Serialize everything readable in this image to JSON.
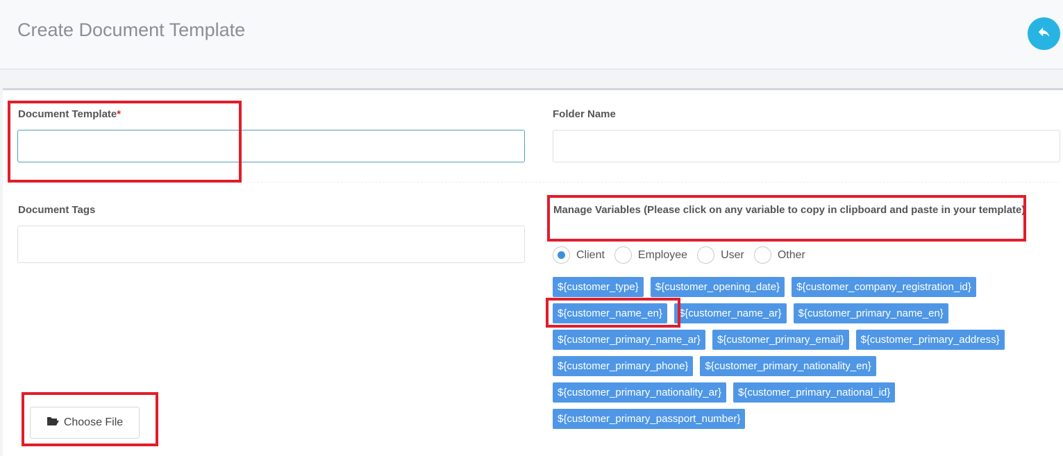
{
  "header": {
    "title": "Create Document Template"
  },
  "form": {
    "document_template": {
      "label": "Document Template",
      "required_mark": "*",
      "value": ""
    },
    "folder_name": {
      "label": "Folder Name",
      "value": ""
    },
    "document_tags": {
      "label": "Document Tags",
      "value": ""
    },
    "variables": {
      "label": "Manage Variables (Please click on any variable to copy in clipboard and paste in your template)",
      "radio_options": [
        "Client",
        "Employee",
        "User",
        "Other"
      ],
      "selected": "Client",
      "chips": [
        [
          "${customer_type}",
          "${customer_opening_date}",
          "${customer_company_registration_id}"
        ],
        [
          "${customer_name_en}",
          "${customer_name_ar}",
          "${customer_primary_name_en}"
        ],
        [
          "${customer_primary_name_ar}",
          "${customer_primary_email}",
          "${customer_primary_address}"
        ],
        [
          "${customer_primary_phone}",
          "${customer_primary_nationality_en}"
        ],
        [
          "${customer_primary_nationality_ar}",
          "${customer_primary_national_id}"
        ],
        [
          "${customer_primary_passport_number}"
        ]
      ]
    },
    "file_button": {
      "label": "Choose File",
      "icon": "folder-open-icon"
    }
  },
  "colors": {
    "accent": "#27b4e3",
    "chip": "#4f97e6",
    "highlight": "#e11d2a",
    "required": "#e02424"
  }
}
